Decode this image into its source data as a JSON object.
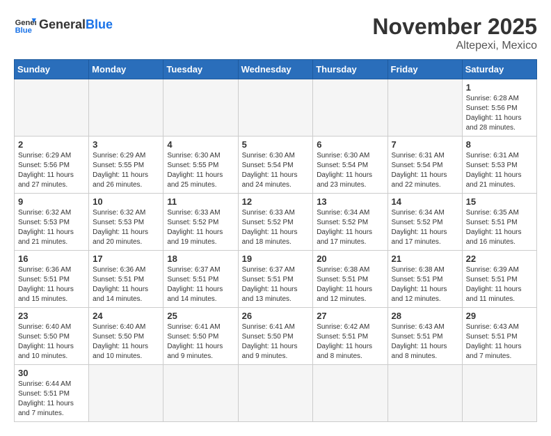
{
  "header": {
    "logo_general": "General",
    "logo_blue": "Blue",
    "month_title": "November 2025",
    "location": "Altepexi, Mexico"
  },
  "weekdays": [
    "Sunday",
    "Monday",
    "Tuesday",
    "Wednesday",
    "Thursday",
    "Friday",
    "Saturday"
  ],
  "cells": [
    {
      "day": "",
      "empty": true
    },
    {
      "day": "",
      "empty": true
    },
    {
      "day": "",
      "empty": true
    },
    {
      "day": "",
      "empty": true
    },
    {
      "day": "",
      "empty": true
    },
    {
      "day": "",
      "empty": true
    },
    {
      "day": "1",
      "sunrise": "6:28 AM",
      "sunset": "5:56 PM",
      "daylight": "11 hours and 28 minutes."
    },
    {
      "day": "2",
      "sunrise": "6:29 AM",
      "sunset": "5:56 PM",
      "daylight": "11 hours and 27 minutes."
    },
    {
      "day": "3",
      "sunrise": "6:29 AM",
      "sunset": "5:55 PM",
      "daylight": "11 hours and 26 minutes."
    },
    {
      "day": "4",
      "sunrise": "6:30 AM",
      "sunset": "5:55 PM",
      "daylight": "11 hours and 25 minutes."
    },
    {
      "day": "5",
      "sunrise": "6:30 AM",
      "sunset": "5:54 PM",
      "daylight": "11 hours and 24 minutes."
    },
    {
      "day": "6",
      "sunrise": "6:30 AM",
      "sunset": "5:54 PM",
      "daylight": "11 hours and 23 minutes."
    },
    {
      "day": "7",
      "sunrise": "6:31 AM",
      "sunset": "5:54 PM",
      "daylight": "11 hours and 22 minutes."
    },
    {
      "day": "8",
      "sunrise": "6:31 AM",
      "sunset": "5:53 PM",
      "daylight": "11 hours and 21 minutes."
    },
    {
      "day": "9",
      "sunrise": "6:32 AM",
      "sunset": "5:53 PM",
      "daylight": "11 hours and 21 minutes."
    },
    {
      "day": "10",
      "sunrise": "6:32 AM",
      "sunset": "5:53 PM",
      "daylight": "11 hours and 20 minutes."
    },
    {
      "day": "11",
      "sunrise": "6:33 AM",
      "sunset": "5:52 PM",
      "daylight": "11 hours and 19 minutes."
    },
    {
      "day": "12",
      "sunrise": "6:33 AM",
      "sunset": "5:52 PM",
      "daylight": "11 hours and 18 minutes."
    },
    {
      "day": "13",
      "sunrise": "6:34 AM",
      "sunset": "5:52 PM",
      "daylight": "11 hours and 17 minutes."
    },
    {
      "day": "14",
      "sunrise": "6:34 AM",
      "sunset": "5:52 PM",
      "daylight": "11 hours and 17 minutes."
    },
    {
      "day": "15",
      "sunrise": "6:35 AM",
      "sunset": "5:51 PM",
      "daylight": "11 hours and 16 minutes."
    },
    {
      "day": "16",
      "sunrise": "6:36 AM",
      "sunset": "5:51 PM",
      "daylight": "11 hours and 15 minutes."
    },
    {
      "day": "17",
      "sunrise": "6:36 AM",
      "sunset": "5:51 PM",
      "daylight": "11 hours and 14 minutes."
    },
    {
      "day": "18",
      "sunrise": "6:37 AM",
      "sunset": "5:51 PM",
      "daylight": "11 hours and 14 minutes."
    },
    {
      "day": "19",
      "sunrise": "6:37 AM",
      "sunset": "5:51 PM",
      "daylight": "11 hours and 13 minutes."
    },
    {
      "day": "20",
      "sunrise": "6:38 AM",
      "sunset": "5:51 PM",
      "daylight": "11 hours and 12 minutes."
    },
    {
      "day": "21",
      "sunrise": "6:38 AM",
      "sunset": "5:51 PM",
      "daylight": "11 hours and 12 minutes."
    },
    {
      "day": "22",
      "sunrise": "6:39 AM",
      "sunset": "5:51 PM",
      "daylight": "11 hours and 11 minutes."
    },
    {
      "day": "23",
      "sunrise": "6:40 AM",
      "sunset": "5:50 PM",
      "daylight": "11 hours and 10 minutes."
    },
    {
      "day": "24",
      "sunrise": "6:40 AM",
      "sunset": "5:50 PM",
      "daylight": "11 hours and 10 minutes."
    },
    {
      "day": "25",
      "sunrise": "6:41 AM",
      "sunset": "5:50 PM",
      "daylight": "11 hours and 9 minutes."
    },
    {
      "day": "26",
      "sunrise": "6:41 AM",
      "sunset": "5:50 PM",
      "daylight": "11 hours and 9 minutes."
    },
    {
      "day": "27",
      "sunrise": "6:42 AM",
      "sunset": "5:51 PM",
      "daylight": "11 hours and 8 minutes."
    },
    {
      "day": "28",
      "sunrise": "6:43 AM",
      "sunset": "5:51 PM",
      "daylight": "11 hours and 8 minutes."
    },
    {
      "day": "29",
      "sunrise": "6:43 AM",
      "sunset": "5:51 PM",
      "daylight": "11 hours and 7 minutes."
    },
    {
      "day": "30",
      "sunrise": "6:44 AM",
      "sunset": "5:51 PM",
      "daylight": "11 hours and 7 minutes."
    },
    {
      "day": "",
      "empty": true
    },
    {
      "day": "",
      "empty": true
    },
    {
      "day": "",
      "empty": true
    },
    {
      "day": "",
      "empty": true
    },
    {
      "day": "",
      "empty": true
    },
    {
      "day": "",
      "empty": true
    }
  ]
}
